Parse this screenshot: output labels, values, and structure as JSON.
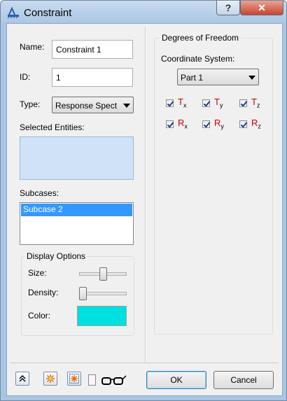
{
  "window": {
    "title": "Constraint",
    "help_label": "?",
    "close_label": "✕"
  },
  "form": {
    "name_label": "Name:",
    "name_value": "Constraint 1",
    "id_label": "ID:",
    "id_value": "1",
    "type_label": "Type:",
    "type_value": "Response Spect",
    "selected_entities_label": "Selected Entities:",
    "subcases_label": "Subcases:",
    "subcases": [
      "Subcase 2"
    ]
  },
  "display_options": {
    "title": "Display Options",
    "size_label": "Size:",
    "size_level": 0.5,
    "density_label": "Density:",
    "density_level": 0.0,
    "color_label": "Color:",
    "color": "#00e0e0"
  },
  "dof": {
    "title": "Degrees of Freedom",
    "coord_label": "Coordinate System:",
    "coord_value": "Part 1",
    "items": [
      {
        "main": "T",
        "sub": "x",
        "checked": true
      },
      {
        "main": "T",
        "sub": "y",
        "checked": true
      },
      {
        "main": "T",
        "sub": "z",
        "checked": true
      },
      {
        "main": "R",
        "sub": "x",
        "checked": true
      },
      {
        "main": "R",
        "sub": "y",
        "checked": true
      },
      {
        "main": "R",
        "sub": "z",
        "checked": true
      }
    ]
  },
  "footer": {
    "ok_label": "OK",
    "cancel_label": "Cancel"
  },
  "icons": [
    "constraint-title-icon",
    "expand-icon",
    "select-icon",
    "select-all-icon",
    "page-icon",
    "glasses-icon"
  ]
}
